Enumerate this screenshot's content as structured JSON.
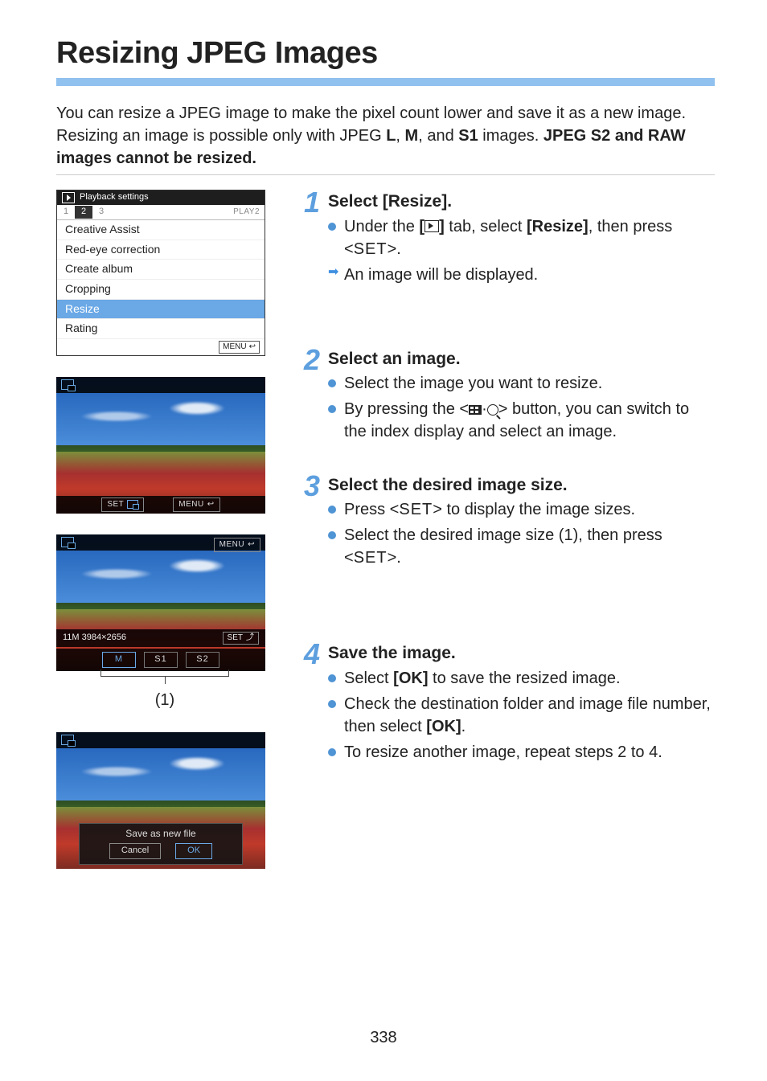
{
  "page_number": "338",
  "title": "Resizing JPEG Images",
  "intro": {
    "part1": "You can resize a JPEG image to make the pixel count lower and save it as a new image. Resizing an image is possible only with JPEG ",
    "sizeL": "L",
    "sep1": ", ",
    "sizeM": "M",
    "sep2": ", and ",
    "sizeS1": "S1",
    "part2": " images. ",
    "boldPrefix": "JPEG ",
    "sizeS2": "S2",
    "boldRest": " and RAW images cannot be resized."
  },
  "screenshots": {
    "menu": {
      "header": "Playback settings",
      "tabs": [
        "1",
        "2",
        "3"
      ],
      "tabLabel": "PLAY2",
      "items": [
        "Creative Assist",
        "Red-eye correction",
        "Create album",
        "Cropping",
        "Resize",
        "Rating"
      ],
      "selected": "Resize",
      "menuBtn": "MENU"
    },
    "imageView": {
      "setBtn": "SET",
      "menuBtn": "MENU"
    },
    "sizeSelect": {
      "resolutionLine": "11M  3984×2656",
      "setBtn": "SET",
      "menuBtn": "MENU",
      "sizes": [
        "M",
        "S1",
        "S2"
      ],
      "callout": "(1)"
    },
    "saveDialog": {
      "title": "Save as new file",
      "cancel": "Cancel",
      "ok": "OK"
    }
  },
  "steps": {
    "s1": {
      "num": "1",
      "title": "Select [Resize].",
      "b1a": "Under the ",
      "b1b": " tab, select ",
      "b1c": "[Resize]",
      "b1d": ", then press <",
      "b1e": ">.",
      "arrow": "An image will be displayed."
    },
    "s2": {
      "num": "2",
      "title": "Select an image.",
      "b1": "Select the image you want to resize.",
      "b2a": "By pressing the <",
      "b2b": "> button, you can switch to the index display and select an image."
    },
    "s3": {
      "num": "3",
      "title": "Select the desired image size.",
      "b1a": "Press <",
      "b1b": "> to display the image sizes.",
      "b2a": "Select the desired image size (1), then press <",
      "b2b": ">."
    },
    "s4": {
      "num": "4",
      "title": "Save the image.",
      "b1a": "Select ",
      "b1b": "[OK]",
      "b1c": " to save the resized image.",
      "b2a": "Check the destination folder and image file number, then select ",
      "b2b": "[OK]",
      "b2c": ".",
      "b3": "To resize another image, repeat steps 2 to 4."
    }
  },
  "glyphs": {
    "set": "SET",
    "bracketOpen": "[",
    "bracketClose": "]"
  }
}
